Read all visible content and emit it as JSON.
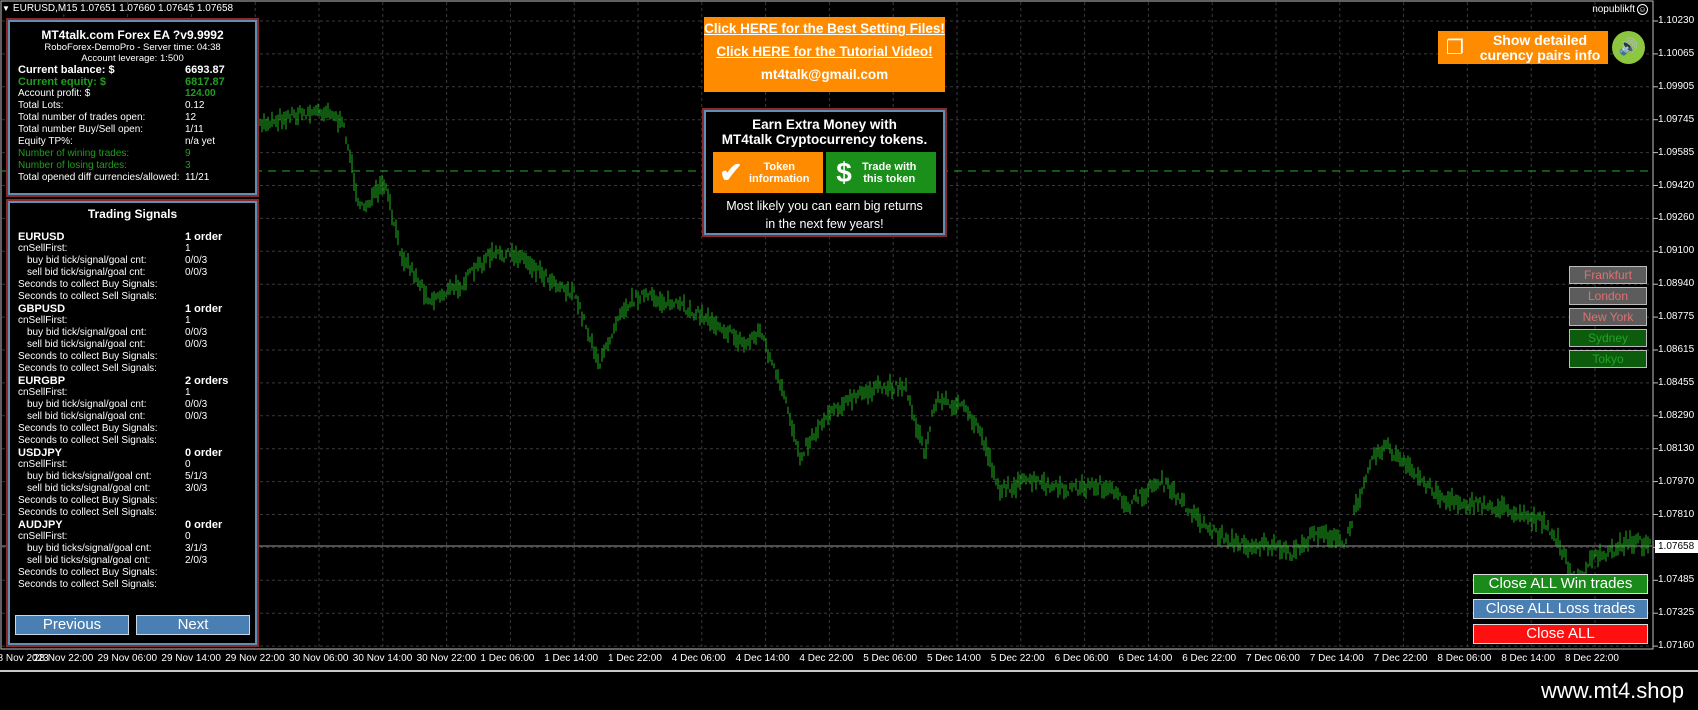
{
  "header": {
    "symbol_line": "EURUSD,M15  1.07651 1.07660 1.07645 1.07658",
    "brand": "nopublikft"
  },
  "price_axis": {
    "labels": [
      "1.10230",
      "1.10065",
      "1.09905",
      "1.09745",
      "1.09585",
      "1.09420",
      "1.09260",
      "1.09100",
      "1.08940",
      "1.08775",
      "1.08615",
      "1.08455",
      "1.08290",
      "1.08130",
      "1.07970",
      "1.07810",
      "1.07650",
      "1.07485",
      "1.07325",
      "1.07160"
    ],
    "current_price": "1.07658"
  },
  "time_axis": {
    "labels": [
      "28 Nov 2023",
      "28 Nov 22:00",
      "29 Nov 06:00",
      "29 Nov 14:00",
      "29 Nov 22:00",
      "30 Nov 06:00",
      "30 Nov 14:00",
      "30 Nov 22:00",
      "1 Dec 06:00",
      "1 Dec 14:00",
      "1 Dec 22:00",
      "4 Dec 06:00",
      "4 Dec 14:00",
      "4 Dec 22:00",
      "5 Dec 06:00",
      "5 Dec 14:00",
      "5 Dec 22:00",
      "6 Dec 06:00",
      "6 Dec 14:00",
      "6 Dec 22:00",
      "7 Dec 06:00",
      "7 Dec 14:00",
      "7 Dec 22:00",
      "8 Dec 06:00",
      "8 Dec 14:00",
      "8 Dec 22:00"
    ]
  },
  "info_panel": {
    "title": "MT4talk.com Forex EA ?v9.9992",
    "server": "RoboForex-DemoPro - Server time: 04:38",
    "leverage": "Account leverage: 1:500",
    "rows": [
      {
        "label": "Current balance: $",
        "value": "6693.87",
        "style": "bold"
      },
      {
        "label": "Current equity: $",
        "value": "6817.87",
        "style": "green"
      },
      {
        "label": "Account profit: $",
        "value": "124.00",
        "style": "profit"
      },
      {
        "label": "Total Lots:",
        "value": "0.12",
        "style": ""
      },
      {
        "label": "Total number of trades open:",
        "value": "12",
        "style": ""
      },
      {
        "label": "Total number Buy/Sell open:",
        "value": "1/11",
        "style": ""
      },
      {
        "label": "Equity  TP%:",
        "value": "n/a yet",
        "style": ""
      },
      {
        "label": "Number of wining trades:",
        "value": "9",
        "style": "dim"
      },
      {
        "label": "Number of losing tardes:",
        "value": "3",
        "style": "dim"
      },
      {
        "label": "Total opened diff currencies/allowed:",
        "value": "11/21",
        "style": ""
      }
    ]
  },
  "signals_panel": {
    "title": "Trading Signals",
    "pairs": [
      {
        "name": "EURUSD",
        "orders": "1 order",
        "first": "1",
        "buy_label": "buy bid tick/signal/goal cnt:",
        "buy": "0/0/3",
        "sell_label": "sell bid tick/signal/goal cnt:",
        "sell": "0/0/3"
      },
      {
        "name": "GBPUSD",
        "orders": "1 order",
        "first": "1",
        "buy_label": "buy bid tick/signal/goal cnt:",
        "buy": "0/0/3",
        "sell_label": "sell bid tick/signal/goal cnt:",
        "sell": "0/0/3"
      },
      {
        "name": "EURGBP",
        "orders": "2 orders",
        "first": "1",
        "buy_label": "buy bid tick/signal/goal cnt:",
        "buy": "0/0/3",
        "sell_label": "sell bid tick/signal/goal cnt:",
        "sell": "0/0/3"
      },
      {
        "name": "USDJPY",
        "orders": "0 order",
        "first": "0",
        "buy_label": "buy bid ticks/signal/goal cnt:",
        "buy": "5/1/3",
        "sell_label": "sell bid ticks/signal/goal cnt:",
        "sell": "3/0/3"
      },
      {
        "name": "AUDJPY",
        "orders": "0 order",
        "first": "0",
        "buy_label": "buy bid ticks/signal/goal cnt:",
        "buy": "3/1/3",
        "sell_label": "sell bid ticks/signal/goal cnt:",
        "sell": "2/0/3"
      }
    ],
    "first_label": "cnSellFirst:",
    "collect_buy": "Seconds to collect Buy Signals:",
    "collect_sell": "Seconds to collect Sell Signals:",
    "prev_label": "Previous",
    "next_label": "Next"
  },
  "links_box": {
    "link1": "Click HERE for the Best Setting Files!",
    "link2": "Click HERE for the Tutorial Video!",
    "email": "mt4talk@gmail.com"
  },
  "crypto_box": {
    "title1": "Earn Extra Money with",
    "title2": "MT4talk Cryptocurrency tokens.",
    "btn_info_l1": "Token",
    "btn_info_l2": "information",
    "btn_trade_l1": "Trade with",
    "btn_trade_l2": "this token",
    "foot1": "Most likely you can earn big returns",
    "foot2": "in the next few years!"
  },
  "show_detailed": {
    "line1": "Show detailed",
    "line2": "curency pairs info"
  },
  "sessions": [
    {
      "name": "Frankfurt",
      "state": "closed"
    },
    {
      "name": "London",
      "state": "closed"
    },
    {
      "name": "New York",
      "state": "closed"
    },
    {
      "name": "Sydney",
      "state": "open"
    },
    {
      "name": "Tokyo",
      "state": "open"
    }
  ],
  "close_buttons": {
    "win": "Close ALL Win trades",
    "loss": "Close ALL Loss trades",
    "all": "Close ALL"
  },
  "footer": {
    "site": "www.mt4.shop"
  },
  "colors": {
    "candle": "#1fae1f",
    "grid": "#3a3a3a",
    "accent_orange": "#ff8c00",
    "panel_border": "#5f8fb5"
  }
}
